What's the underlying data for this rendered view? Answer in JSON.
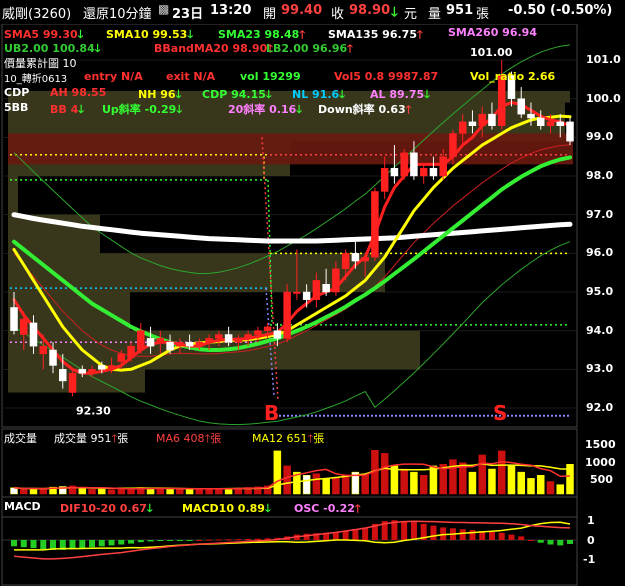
{
  "header": {
    "stock": "威剛(3260)",
    "mode": "還原10分鐘",
    "date": "23日",
    "time": "13:20",
    "open_label": "開",
    "open_value": "99.40",
    "close_label": "收",
    "close_value": "98.90",
    "close_unit": "元",
    "volume_label": "量",
    "volume_value": "951",
    "volume_unit": "張",
    "change": "-0.50 (-0.50%)"
  },
  "indicators": {
    "row1": [
      {
        "label": "SMA5 99.30",
        "arrow": "down",
        "color": "#ff3030"
      },
      {
        "label": "SMA10 99.53",
        "arrow": "down",
        "color": "#ffff00"
      },
      {
        "label": "SMA23 98.48",
        "arrow": "up",
        "color": "#33ff33"
      },
      {
        "label": "SMA135 96.75",
        "arrow": "up",
        "color": "#ffffff"
      },
      {
        "label": "SMA260 96.94",
        "arrow": "none",
        "color": "#ff80ff"
      }
    ],
    "row2": [
      {
        "label": "UB2.00 100.84",
        "arrow": "down",
        "color": "#33cc33"
      },
      {
        "label": "BBandMA20 98.90",
        "arrow": "up",
        "color": "#ff3030"
      },
      {
        "label": "LB2.00 96.96",
        "arrow": "up",
        "color": "#33cc33"
      }
    ],
    "row3": "價量累計圖 10",
    "row4": [
      {
        "label": "10_轉折0613",
        "color": "#ffffff"
      },
      {
        "label": "entry N/A",
        "color": "#ff3030"
      },
      {
        "label": "exit N/A",
        "color": "#ff3030"
      },
      {
        "label": "vol 19299",
        "color": "#33ff33"
      },
      {
        "label": "Vol5 0.8 9987.87",
        "color": "#ff3030"
      },
      {
        "label": "Vol_ratio 2.66",
        "color": "#ffff00"
      }
    ],
    "row5": [
      {
        "label": "CDP",
        "color": "#ffffff"
      },
      {
        "label": "AH 98.55",
        "color": "#ff3030",
        "arrow": "none"
      },
      {
        "label": "NH 96",
        "color": "#ffff00",
        "arrow": "down"
      },
      {
        "label": "CDP 94.15",
        "color": "#33ff33",
        "arrow": "down"
      },
      {
        "label": "NL 91.6",
        "color": "#00ccff",
        "arrow": "down"
      },
      {
        "label": "AL 89.75",
        "color": "#ff80ff",
        "arrow": "down"
      }
    ],
    "row6": [
      {
        "label": "5BB",
        "color": "#ffffff"
      },
      {
        "label": "BB 4",
        "color": "#ff3030",
        "arrow": "down"
      },
      {
        "label": "Up斜率 -0.29",
        "color": "#33ff33",
        "arrow": "down"
      },
      {
        "label": "20斜率 0.16",
        "color": "#ff80ff",
        "arrow": "down"
      },
      {
        "label": "Down斜率 0.63",
        "color": "#ffffff",
        "arrow": "up"
      }
    ]
  },
  "volume_panel": {
    "title": "成交量",
    "vol_label": "成交量 951",
    "vol_unit": "張",
    "ma6": "MA6 408",
    "ma6_unit": "張",
    "ma12": "MA12 651",
    "ma12_unit": "張",
    "axis": [
      "1500",
      "1000",
      "500"
    ]
  },
  "macd_panel": {
    "title": "MACD",
    "dif": "DIF10-20 0.67",
    "macd": "MACD10 0.89",
    "osc": "OSC -0.22",
    "axis": [
      "1",
      "0",
      "-1"
    ]
  },
  "chart_data": {
    "type": "candlestick",
    "y_axis_ticks": [
      "101.0",
      "100.0",
      "99.0",
      "98.0",
      "97.0",
      "96.0",
      "95.0",
      "94.0",
      "93.0",
      "92.0"
    ],
    "ylim": [
      91.7,
      101.4
    ],
    "annotations": {
      "high": "101.00",
      "low": "92.30",
      "buy_signal": "B",
      "sell_signal": "S"
    },
    "candles": [
      {
        "o": 94.6,
        "h": 95.0,
        "l": 93.9,
        "c": 94.0
      },
      {
        "o": 93.9,
        "h": 94.5,
        "l": 93.5,
        "c": 94.3
      },
      {
        "o": 94.2,
        "h": 94.4,
        "l": 93.4,
        "c": 93.6
      },
      {
        "o": 93.4,
        "h": 93.9,
        "l": 93.0,
        "c": 93.6
      },
      {
        "o": 93.5,
        "h": 93.7,
        "l": 92.9,
        "c": 93.1
      },
      {
        "o": 93.0,
        "h": 93.4,
        "l": 92.5,
        "c": 92.7
      },
      {
        "o": 92.4,
        "h": 93.0,
        "l": 92.3,
        "c": 92.9
      },
      {
        "o": 93.0,
        "h": 93.1,
        "l": 92.8,
        "c": 92.9
      },
      {
        "o": 92.9,
        "h": 93.1,
        "l": 92.8,
        "c": 93.0
      },
      {
        "o": 93.1,
        "h": 93.2,
        "l": 92.9,
        "c": 93.0
      },
      {
        "o": 93.0,
        "h": 93.3,
        "l": 92.9,
        "c": 93.1
      },
      {
        "o": 93.2,
        "h": 93.5,
        "l": 93.0,
        "c": 93.4
      },
      {
        "o": 93.3,
        "h": 93.7,
        "l": 93.2,
        "c": 93.6
      },
      {
        "o": 93.5,
        "h": 94.2,
        "l": 93.4,
        "c": 94.0
      },
      {
        "o": 93.8,
        "h": 94.1,
        "l": 93.4,
        "c": 93.6
      },
      {
        "o": 93.7,
        "h": 94.0,
        "l": 93.4,
        "c": 93.8
      },
      {
        "o": 93.7,
        "h": 93.9,
        "l": 93.4,
        "c": 93.5
      },
      {
        "o": 93.6,
        "h": 93.8,
        "l": 93.4,
        "c": 93.7
      },
      {
        "o": 93.7,
        "h": 93.9,
        "l": 93.5,
        "c": 93.6
      },
      {
        "o": 93.6,
        "h": 93.8,
        "l": 93.5,
        "c": 93.7
      },
      {
        "o": 93.7,
        "h": 93.9,
        "l": 93.5,
        "c": 93.8
      },
      {
        "o": 93.8,
        "h": 94.0,
        "l": 93.6,
        "c": 93.9
      },
      {
        "o": 93.9,
        "h": 94.1,
        "l": 93.6,
        "c": 93.7
      },
      {
        "o": 93.7,
        "h": 93.9,
        "l": 93.5,
        "c": 93.8
      },
      {
        "o": 93.8,
        "h": 94.0,
        "l": 93.6,
        "c": 93.9
      },
      {
        "o": 93.9,
        "h": 94.1,
        "l": 93.7,
        "c": 94.0
      },
      {
        "o": 94.0,
        "h": 94.2,
        "l": 93.8,
        "c": 94.1
      },
      {
        "o": 94.0,
        "h": 94.2,
        "l": 93.6,
        "c": 93.8
      },
      {
        "o": 93.8,
        "h": 95.2,
        "l": 93.7,
        "c": 95.0
      },
      {
        "o": 95.0,
        "h": 96.1,
        "l": 94.8,
        "c": 95.0
      },
      {
        "o": 95.0,
        "h": 95.2,
        "l": 94.6,
        "c": 94.8
      },
      {
        "o": 94.8,
        "h": 95.5,
        "l": 94.6,
        "c": 95.3
      },
      {
        "o": 95.2,
        "h": 95.6,
        "l": 94.9,
        "c": 95.0
      },
      {
        "o": 95.0,
        "h": 95.8,
        "l": 94.9,
        "c": 95.6
      },
      {
        "o": 95.6,
        "h": 96.1,
        "l": 95.3,
        "c": 96.0
      },
      {
        "o": 96.0,
        "h": 96.3,
        "l": 95.6,
        "c": 95.8
      },
      {
        "o": 95.8,
        "h": 96.0,
        "l": 95.4,
        "c": 95.9
      },
      {
        "o": 95.9,
        "h": 97.7,
        "l": 95.8,
        "c": 97.6
      },
      {
        "o": 97.6,
        "h": 98.5,
        "l": 97.4,
        "c": 98.2
      },
      {
        "o": 98.2,
        "h": 98.8,
        "l": 97.8,
        "c": 98.0
      },
      {
        "o": 98.0,
        "h": 98.7,
        "l": 97.9,
        "c": 98.6
      },
      {
        "o": 98.6,
        "h": 98.9,
        "l": 97.9,
        "c": 98.0
      },
      {
        "o": 98.0,
        "h": 98.3,
        "l": 97.8,
        "c": 98.2
      },
      {
        "o": 98.2,
        "h": 98.5,
        "l": 97.9,
        "c": 98.0
      },
      {
        "o": 98.0,
        "h": 98.7,
        "l": 97.9,
        "c": 98.5
      },
      {
        "o": 98.5,
        "h": 99.2,
        "l": 98.3,
        "c": 99.1
      },
      {
        "o": 99.1,
        "h": 99.6,
        "l": 98.8,
        "c": 99.4
      },
      {
        "o": 99.4,
        "h": 99.7,
        "l": 99.1,
        "c": 99.3
      },
      {
        "o": 99.3,
        "h": 99.8,
        "l": 99.0,
        "c": 99.6
      },
      {
        "o": 99.6,
        "h": 99.9,
        "l": 99.2,
        "c": 99.3
      },
      {
        "o": 99.3,
        "h": 101.0,
        "l": 99.2,
        "c": 100.6
      },
      {
        "o": 100.6,
        "h": 100.7,
        "l": 99.8,
        "c": 100.0
      },
      {
        "o": 100.0,
        "h": 100.3,
        "l": 99.5,
        "c": 99.6
      },
      {
        "o": 99.6,
        "h": 99.9,
        "l": 99.3,
        "c": 99.5
      },
      {
        "o": 99.5,
        "h": 99.7,
        "l": 99.2,
        "c": 99.3
      },
      {
        "o": 99.3,
        "h": 99.6,
        "l": 99.1,
        "c": 99.4
      },
      {
        "o": 99.4,
        "h": 99.6,
        "l": 99.0,
        "c": 99.3
      },
      {
        "o": 99.4,
        "h": 99.5,
        "l": 98.8,
        "c": 98.9
      }
    ],
    "series": [
      {
        "name": "SMA5",
        "color": "#ff2020",
        "width": 3,
        "values": [
          94.8,
          94.4,
          94.1,
          93.8,
          93.5,
          93.2,
          93.0,
          92.9,
          92.9,
          92.95,
          93.0,
          93.1,
          93.3,
          93.5,
          93.65,
          93.7,
          93.7,
          93.65,
          93.6,
          93.6,
          93.7,
          93.75,
          93.78,
          93.78,
          93.8,
          93.85,
          93.9,
          93.95,
          94.2,
          94.5,
          94.7,
          94.9,
          95.0,
          95.1,
          95.4,
          95.7,
          95.9,
          96.5,
          97.2,
          97.7,
          98.0,
          98.3,
          98.3,
          98.3,
          98.3,
          98.5,
          98.8,
          99.0,
          99.3,
          99.5,
          99.8,
          99.9,
          99.85,
          99.7,
          99.55,
          99.45,
          99.4,
          99.3
        ]
      },
      {
        "name": "SMA10",
        "color": "#ffff00",
        "width": 3,
        "values": [
          96.1,
          95.7,
          95.3,
          94.9,
          94.5,
          94.1,
          93.8,
          93.5,
          93.3,
          93.1,
          93.0,
          92.98,
          93.0,
          93.1,
          93.2,
          93.35,
          93.5,
          93.6,
          93.65,
          93.68,
          93.7,
          93.72,
          93.75,
          93.75,
          93.77,
          93.8,
          93.85,
          93.9,
          94.0,
          94.15,
          94.3,
          94.45,
          94.6,
          94.75,
          94.9,
          95.1,
          95.3,
          95.6,
          95.9,
          96.3,
          96.7,
          97.1,
          97.4,
          97.7,
          97.95,
          98.2,
          98.4,
          98.6,
          98.8,
          98.95,
          99.1,
          99.25,
          99.35,
          99.45,
          99.5,
          99.52,
          99.55,
          99.53
        ]
      },
      {
        "name": "SMA23",
        "color": "#33ee33",
        "width": 4,
        "values": [
          96.3,
          96.1,
          95.9,
          95.7,
          95.5,
          95.3,
          95.1,
          94.9,
          94.7,
          94.55,
          94.4,
          94.25,
          94.1,
          93.98,
          93.88,
          93.78,
          93.7,
          93.63,
          93.57,
          93.52,
          93.5,
          93.5,
          93.52,
          93.55,
          93.6,
          93.66,
          93.73,
          93.8,
          93.9,
          94.0,
          94.1,
          94.22,
          94.35,
          94.48,
          94.62,
          94.78,
          94.93,
          95.1,
          95.28,
          95.47,
          95.66,
          95.85,
          96.05,
          96.25,
          96.45,
          96.65,
          96.85,
          97.05,
          97.25,
          97.45,
          97.65,
          97.82,
          97.98,
          98.12,
          98.25,
          98.35,
          98.43,
          98.48
        ]
      },
      {
        "name": "SMA135",
        "color": "#ffffff",
        "width": 5,
        "values": [
          97.0,
          96.95,
          96.9,
          96.86,
          96.82,
          96.78,
          96.74,
          96.7,
          96.67,
          96.64,
          96.61,
          96.58,
          96.55,
          96.52,
          96.5,
          96.48,
          96.46,
          96.44,
          96.42,
          96.4,
          96.38,
          96.37,
          96.36,
          96.35,
          96.34,
          96.33,
          96.32,
          96.32,
          96.32,
          96.32,
          96.32,
          96.32,
          96.33,
          96.34,
          96.35,
          96.36,
          96.37,
          96.38,
          96.39,
          96.4,
          96.42,
          96.44,
          96.46,
          96.48,
          96.5,
          96.52,
          96.54,
          96.56,
          96.58,
          96.6,
          96.62,
          96.64,
          96.66,
          96.68,
          96.7,
          96.72,
          96.74,
          96.75
        ]
      }
    ],
    "volume": [
      200,
      150,
      180,
      160,
      220,
      240,
      260,
      180,
      150,
      160,
      140,
      170,
      190,
      210,
      180,
      160,
      150,
      170,
      160,
      180,
      170,
      160,
      180,
      190,
      210,
      230,
      260,
      1380,
      900,
      700,
      600,
      650,
      500,
      520,
      600,
      700,
      650,
      1400,
      1300,
      900,
      800,
      700,
      600,
      900,
      950,
      1100,
      1000,
      700,
      1250,
      800,
      1380,
      900,
      700,
      500,
      600,
      400,
      300,
      951
    ],
    "volume_up": [
      0,
      1,
      0,
      1,
      0,
      0,
      1,
      0,
      1,
      0,
      1,
      1,
      1,
      1,
      0,
      1,
      0,
      1,
      0,
      1,
      1,
      1,
      0,
      1,
      1,
      1,
      1,
      0,
      1,
      0,
      0,
      1,
      0,
      1,
      1,
      0,
      1,
      1,
      1,
      0,
      1,
      0,
      1,
      0,
      1,
      1,
      1,
      0,
      1,
      0,
      1,
      0,
      0,
      0,
      0,
      1,
      0,
      0
    ],
    "osc": [
      -0.35,
      -0.4,
      -0.45,
      -0.5,
      -0.55,
      -0.55,
      -0.5,
      -0.45,
      -0.4,
      -0.35,
      -0.3,
      -0.25,
      -0.2,
      -0.12,
      -0.08,
      -0.05,
      -0.03,
      -0.02,
      -0.01,
      0.0,
      0.02,
      0.03,
      0.04,
      0.05,
      0.06,
      0.07,
      0.09,
      0.12,
      0.2,
      0.3,
      0.35,
      0.38,
      0.4,
      0.42,
      0.5,
      0.6,
      0.7,
      0.9,
      1.05,
      1.1,
      1.05,
      1.0,
      0.9,
      0.8,
      0.7,
      0.65,
      0.6,
      0.55,
      0.5,
      0.45,
      0.4,
      0.3,
      0.2,
      0.0,
      -0.15,
      -0.25,
      -0.3,
      -0.22
    ],
    "dif": [
      -0.9,
      -0.95,
      -1.0,
      -1.05,
      -1.05,
      -1.02,
      -0.98,
      -0.92,
      -0.86,
      -0.8,
      -0.75,
      -0.7,
      -0.62,
      -0.55,
      -0.48,
      -0.42,
      -0.36,
      -0.31,
      -0.27,
      -0.23,
      -0.2,
      -0.17,
      -0.14,
      -0.11,
      -0.08,
      -0.05,
      -0.02,
      0.02,
      0.1,
      0.18,
      0.24,
      0.3,
      0.36,
      0.42,
      0.5,
      0.58,
      0.66,
      0.78,
      0.9,
      0.98,
      1.02,
      1.04,
      1.03,
      1.02,
      1.0,
      0.98,
      0.97,
      0.96,
      0.95,
      0.94,
      0.93,
      0.9,
      0.86,
      0.8,
      0.76,
      0.72,
      0.69,
      0.67
    ],
    "macd": [
      -0.55,
      -0.55,
      -0.55,
      -0.55,
      -0.5,
      -0.47,
      -0.48,
      -0.47,
      -0.46,
      -0.45,
      -0.45,
      -0.45,
      -0.42,
      -0.43,
      -0.4,
      -0.37,
      -0.33,
      -0.29,
      -0.26,
      -0.23,
      -0.22,
      -0.2,
      -0.18,
      -0.16,
      -0.14,
      -0.12,
      -0.11,
      -0.1,
      -0.1,
      -0.12,
      -0.11,
      -0.08,
      -0.04,
      0.0,
      0.0,
      -0.02,
      -0.04,
      -0.12,
      -0.15,
      -0.12,
      -0.03,
      0.04,
      0.13,
      0.22,
      0.3,
      0.33,
      0.37,
      0.41,
      0.45,
      0.49,
      0.53,
      0.6,
      0.66,
      0.8,
      0.91,
      0.97,
      0.99,
      0.89
    ]
  }
}
